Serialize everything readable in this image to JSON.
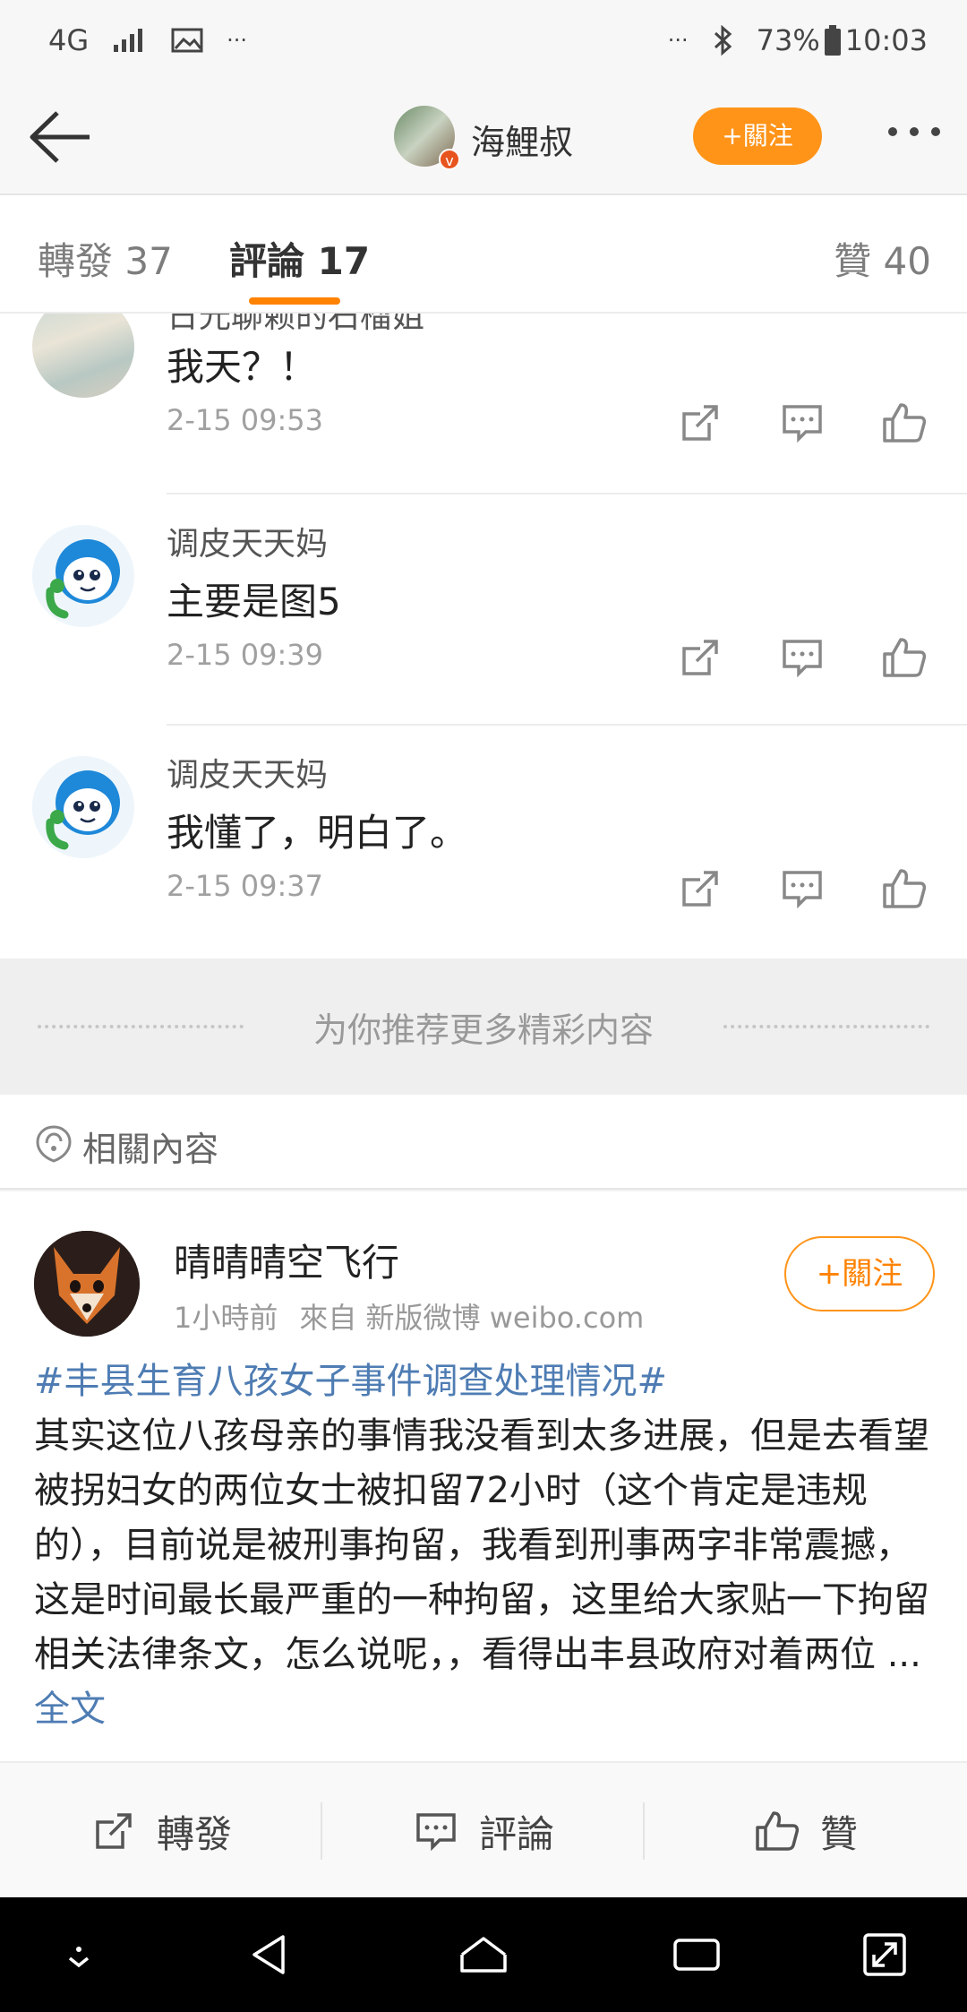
{
  "status_bar": {
    "network": "4G",
    "more": "···",
    "right_more": "···",
    "battery": "73%",
    "time": "10:03"
  },
  "header": {
    "name": "海鯉叔",
    "follow_label": "+關注"
  },
  "tabs": [
    {
      "label": "轉發 37"
    },
    {
      "label": "評論 17"
    },
    {
      "label": "贊 40"
    }
  ],
  "comments": [
    {
      "name": "日光聊赖的石榴姐",
      "text": "我天？！",
      "time": "2-15 09:53"
    },
    {
      "name": "调皮天天妈",
      "text": "主要是图5",
      "time": "2-15 09:39"
    },
    {
      "name": "调皮天天妈",
      "text": "我懂了，明白了。",
      "time": "2-15 09:37"
    }
  ],
  "recommend": {
    "label": "为你推荐更多精彩内容"
  },
  "related": {
    "label": "相關內容"
  },
  "post": {
    "name": "晴晴晴空飞行",
    "time": "1小時前",
    "source": "來自 新版微博 weibo.com",
    "follow_label": "+關注",
    "topic": "#丰县生育八孩女子事件调查处理情况#",
    "body": "其实这位八孩母亲的事情我没看到太多进展，但是去看望被拐妇女的两位女士被扣留72小时（这个肯定是违规的），目前说是被刑事拘留，我看到刑事两字非常震撼，这是时间最长最严重的一种拘留，这里给大家贴一下拘留相关法律条文，怎么说呢，，看得出丰县政府对着两位 ...",
    "more_label": "全文"
  },
  "actions": {
    "repost": "轉發",
    "comment": "評論",
    "like": "贊"
  },
  "icons": {
    "repost": "share-out-icon",
    "comment": "comment-bubble-icon",
    "like": "thumbs-up-icon"
  },
  "colors": {
    "accent": "#ff8200",
    "link": "#4e7cb3"
  }
}
